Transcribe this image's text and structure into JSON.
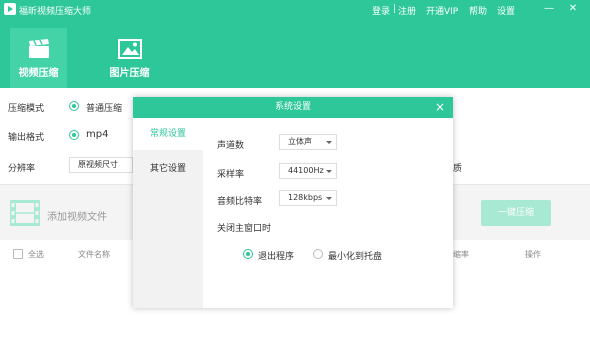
{
  "app": {
    "title": "福昕视频压缩大师",
    "links": {
      "login": "登录",
      "sep": "|",
      "register": "注册",
      "vip": "开通VIP",
      "help": "帮助",
      "settings": "设置"
    },
    "window": {
      "minimize": "—",
      "close": "✕"
    }
  },
  "tabs": [
    {
      "label": "视频压缩",
      "icon": "clapperboard-icon",
      "active": true
    },
    {
      "label": "图片压缩",
      "icon": "image-icon",
      "active": false
    }
  ],
  "main": {
    "mode_label": "压缩模式",
    "mode_value": "普通压缩",
    "format_label": "输出格式",
    "format_value": "mp4",
    "resolution_label": "分辨率",
    "resolution_value": "原视频尺寸",
    "quality_fragment": "质",
    "add_video": "添加视频文件",
    "compress_button": "一键压缩",
    "columns": {
      "select_all": "全选",
      "file_name": "文件名称",
      "compress_col": "缩率",
      "action": "操作"
    }
  },
  "modal": {
    "title": "系统设置",
    "close": "×",
    "side_items": [
      "常规设置",
      "其它设置"
    ],
    "channel_label": "声道数",
    "channel_value": "立体声",
    "sample_label": "采样率",
    "sample_value": "44100Hz",
    "bitrate_label": "音频比特率",
    "bitrate_value": "128kbps",
    "close_main_label": "关闭主窗口时",
    "option_exit": "退出程序",
    "option_tray": "最小化到托盘"
  },
  "colors": {
    "accent": "#2ec79a",
    "tab_active": "#43d3a7",
    "button_disabled": "#a8e9d3"
  }
}
